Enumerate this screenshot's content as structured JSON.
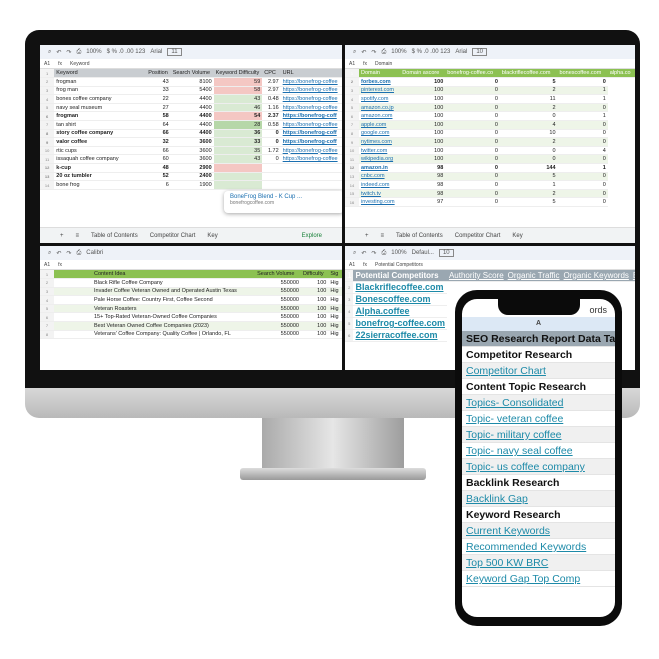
{
  "sheet1": {
    "zoom": "100%",
    "font": "Arial",
    "font_size": "11",
    "cell_ref": "A1",
    "formula": "Keyword",
    "headers": [
      "Keyword",
      "Position",
      "Search Volume",
      "Keyword Difficulty",
      "CPC",
      "URL"
    ],
    "rows": [
      [
        "frogman",
        "43",
        "8100",
        "59",
        "2.97",
        "https://bonefrog-coffee",
        false,
        "bad"
      ],
      [
        "frog man",
        "33",
        "5400",
        "58",
        "2.97",
        "https://bonefrog-coffee",
        false,
        "bad"
      ],
      [
        "bones coffee company",
        "22",
        "4400",
        "43",
        "0.48",
        "https://bonefrog-coffee",
        false,
        "good"
      ],
      [
        "navy seal museum",
        "27",
        "4400",
        "46",
        "1.16",
        "https://bonefrog-coffee",
        false,
        "good"
      ],
      [
        "frogman",
        "58",
        "4400",
        "54",
        "2.37",
        "https://bonefrog-coff",
        true,
        "bad"
      ],
      [
        "tan shirt",
        "64",
        "4400",
        "28",
        "0.58",
        "https://bonefrog-coffee",
        false,
        "best"
      ],
      [
        "story coffee company",
        "66",
        "4400",
        "36",
        "0",
        "https://bonefrog-coff",
        true,
        "good"
      ],
      [
        "valor coffee",
        "32",
        "3600",
        "33",
        "0",
        "https://bonefrog-coff",
        true,
        "good"
      ],
      [
        "rtic cups",
        "66",
        "3600",
        "35",
        "1.72",
        "https://bonefrog-coffee",
        false,
        "good"
      ],
      [
        "issaquah coffee company",
        "60",
        "3600",
        "43",
        "0",
        "https://bonefrog-coffee",
        false,
        "good"
      ],
      [
        "k-cup",
        "48",
        "2900",
        "",
        "",
        "",
        true,
        "bad"
      ],
      [
        "20 oz tumbler",
        "52",
        "2400",
        "",
        "",
        "",
        true,
        "good"
      ],
      [
        "bone frog",
        "6",
        "1900",
        "",
        "",
        "",
        false,
        "good"
      ]
    ],
    "tooltip": {
      "title": "BoneFrog Blend - K Cup ...",
      "url": "bonefrogcoffee.com"
    },
    "tabs": [
      "Table of Contents",
      "Competitor Chart",
      "Key"
    ],
    "explore": "Explore"
  },
  "sheet2": {
    "zoom": "100%",
    "font": "Arial",
    "font_size": "10",
    "cell_ref": "A1",
    "formula": "Domain",
    "headers": [
      "Domain",
      "Domain ascore",
      "bonefrog-coffee.co",
      "blackriflecoffee.com",
      "bonescoffee.com",
      "alpha.co"
    ],
    "rows": [
      [
        "forbes.com",
        "100",
        "0",
        "5",
        "0",
        true
      ],
      [
        "pinterest.com",
        "100",
        "0",
        "2",
        "1",
        false
      ],
      [
        "spotify.com",
        "100",
        "0",
        "11",
        "1",
        false
      ],
      [
        "amazon.co.jp",
        "100",
        "0",
        "2",
        "0",
        false
      ],
      [
        "amazon.com",
        "100",
        "0",
        "0",
        "1",
        false
      ],
      [
        "apple.com",
        "100",
        "0",
        "4",
        "0",
        false
      ],
      [
        "google.com",
        "100",
        "0",
        "10",
        "0",
        false
      ],
      [
        "nytimes.com",
        "100",
        "0",
        "2",
        "0",
        false
      ],
      [
        "twitter.com",
        "100",
        "0",
        "0",
        "4",
        false
      ],
      [
        "wikipedia.org",
        "100",
        "0",
        "0",
        "0",
        false
      ],
      [
        "amazon.in",
        "98",
        "0",
        "144",
        "1",
        true
      ],
      [
        "cnbc.com",
        "98",
        "0",
        "5",
        "0",
        false
      ],
      [
        "indeed.com",
        "98",
        "0",
        "1",
        "0",
        false
      ],
      [
        "twitch.tv",
        "98",
        "0",
        "2",
        "0",
        false
      ],
      [
        "investing.com",
        "97",
        "0",
        "5",
        "0",
        false
      ]
    ],
    "tabs": [
      "Table of Contents",
      "Competitor Chart",
      "Key"
    ]
  },
  "sheet3": {
    "font": "Calibri",
    "cell_ref": "A1",
    "headers": [
      "Content Idea",
      "Search Volume",
      "Difficulty",
      "Sig"
    ],
    "rows": [
      [
        "Black Rifle Coffee Company",
        "550000",
        "100",
        "Hig"
      ],
      [
        "Invader Coffee Veteran Owned and Operated Austin Texas",
        "550000",
        "100",
        "Hig"
      ],
      [
        "Pale Horse Coffee: Country First, Coffee Second",
        "550000",
        "100",
        "Hig"
      ],
      [
        "Veteran Roasters",
        "550000",
        "100",
        "Hig"
      ],
      [
        "15+ Top-Rated Veteran-Owned Coffee Companies",
        "550000",
        "100",
        "Hig"
      ],
      [
        "Best Veteran Owned Coffee Companies (2023)",
        "550000",
        "100",
        "Hig"
      ],
      [
        "Veterans' Coffee Company: Quality Coffee | Orlando, FL",
        "550000",
        "100",
        "Hig"
      ]
    ]
  },
  "sheet4": {
    "zoom": "100%",
    "font": "Defaul...",
    "font_size": "10",
    "cell_ref": "A1",
    "formula": "Potential Competitors",
    "headers": [
      "Potential Competitors",
      "Authority Score",
      "Organic Traffic",
      "Organic Keywords",
      "Ba"
    ],
    "rows": [
      "Blackriflecoffee.com",
      "Bonescoffee.com",
      "Alpha.coffee",
      "bonefrog-coffee.com",
      "22sierracoffee.com"
    ]
  },
  "phone": {
    "tab_label": "ords",
    "col": "A",
    "title": "SEO Research Report Data Table",
    "rows": [
      [
        "Competitor Research",
        "h"
      ],
      [
        "Competitor Chart",
        "l"
      ],
      [
        "Content Topic Research",
        "h"
      ],
      [
        "Topics- Consolidated",
        "l"
      ],
      [
        "Topic- veteran coffee",
        "l"
      ],
      [
        "Topic- military coffee",
        "l"
      ],
      [
        "Topic- navy seal coffee",
        "l"
      ],
      [
        "Topic- us coffee company",
        "l"
      ],
      [
        "Backlink Research",
        "h"
      ],
      [
        "Backlink Gap",
        "l"
      ],
      [
        "Keyword Research",
        "h"
      ],
      [
        "Current Keywords",
        "l"
      ],
      [
        "Recommended Keywords",
        "l"
      ],
      [
        "Top 500 KW BRC",
        "l"
      ],
      [
        "Keyword Gap Top Comp",
        "l"
      ]
    ]
  },
  "colors": {
    "header_green": "#8cc152",
    "header_gray": "#9aa7b1",
    "bad": "#f4c7c3",
    "good": "#d9ead3",
    "best": "#b6d7a8",
    "link": "#1d8aa8"
  }
}
